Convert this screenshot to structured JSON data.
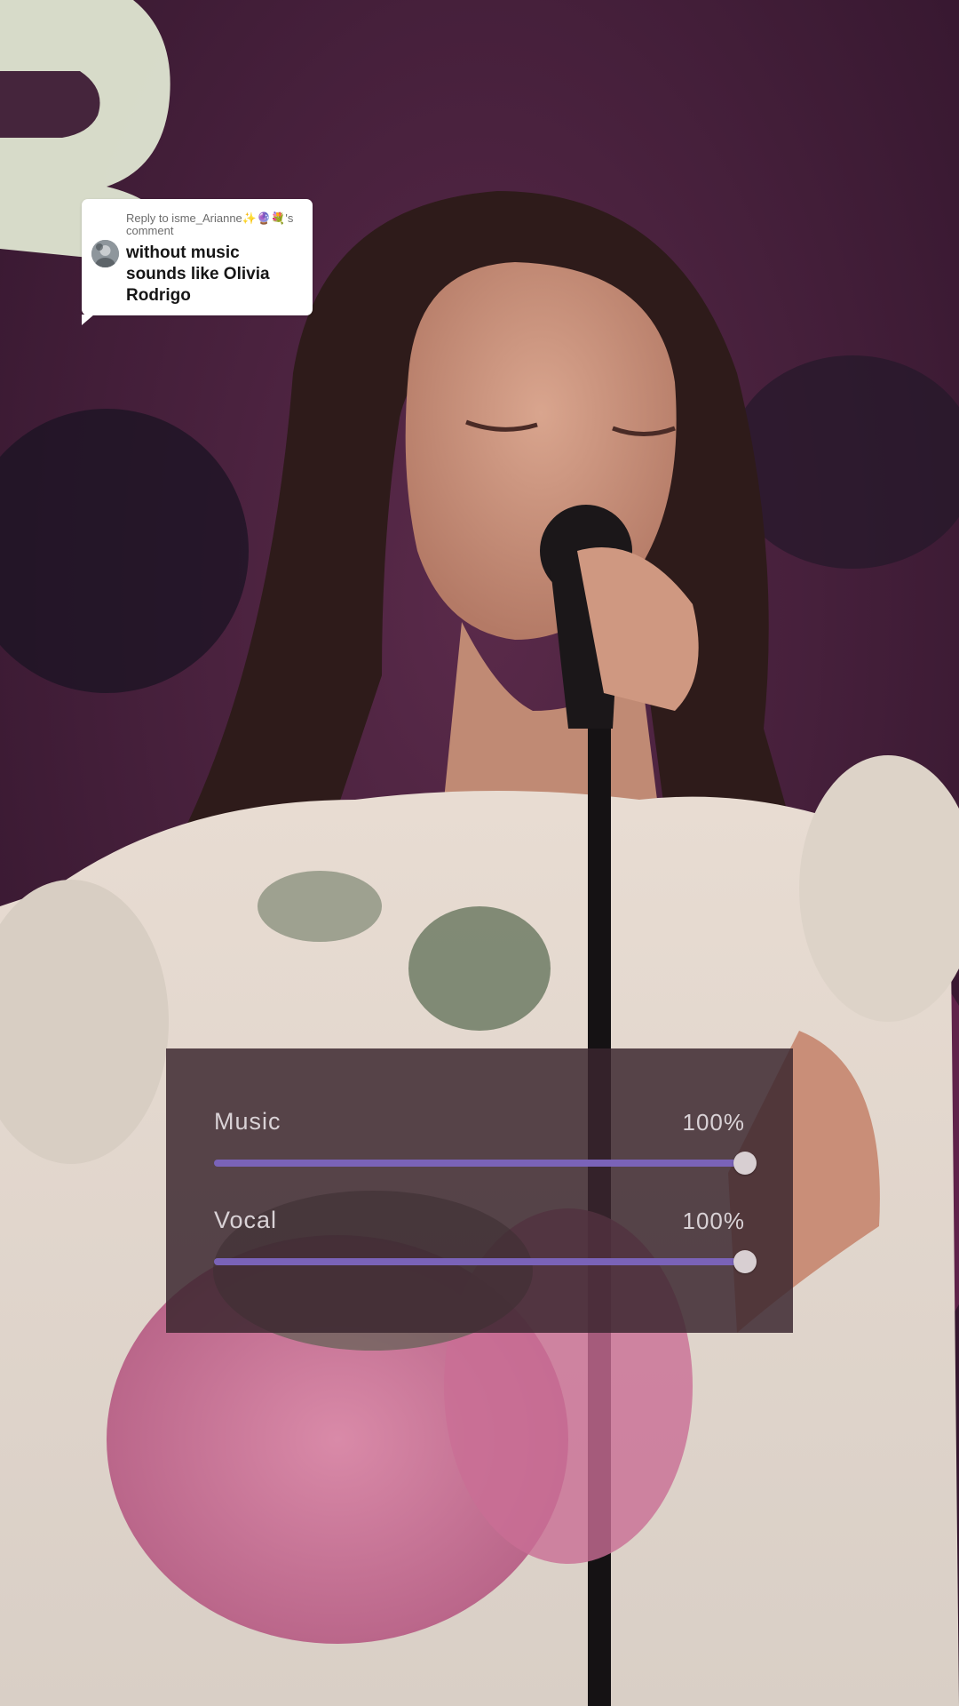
{
  "reply": {
    "header": "Reply to isme_Arianne✨🔮💐's comment",
    "comment": "without music sounds like Olivia Rodrigo"
  },
  "mixer": {
    "music": {
      "label": "Music",
      "value_text": "100%",
      "level": 1.0
    },
    "vocal": {
      "label": "Vocal",
      "value_text": "100%",
      "level": 1.0
    }
  },
  "colors": {
    "slider_fill": "#7a63b8",
    "slider_thumb": "#d8cfd2",
    "panel_bg": "#3a262e"
  }
}
